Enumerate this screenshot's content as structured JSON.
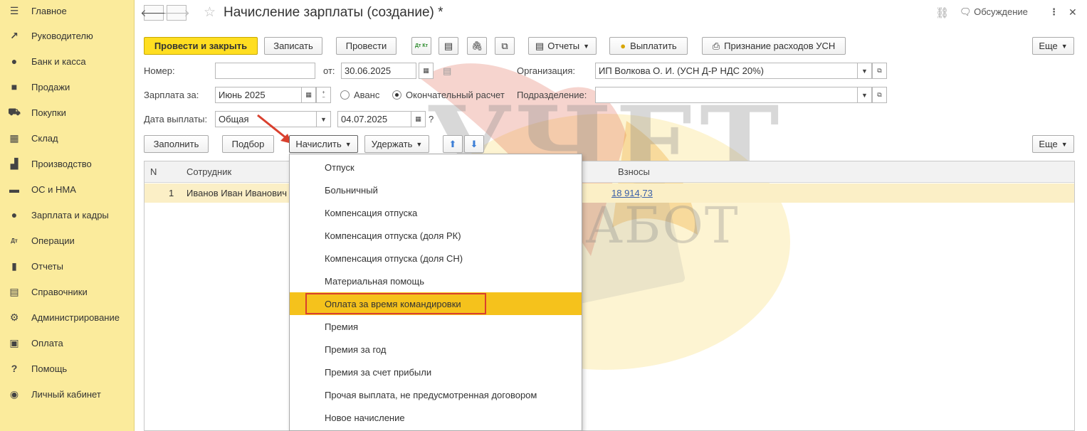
{
  "sidebar": {
    "items": [
      {
        "label": "Главное",
        "icon": "menu-icon"
      },
      {
        "label": "Руководителю",
        "icon": "trend-icon"
      },
      {
        "label": "Банк и касса",
        "icon": "coin-icon"
      },
      {
        "label": "Продажи",
        "icon": "bag-icon"
      },
      {
        "label": "Покупки",
        "icon": "cart-icon"
      },
      {
        "label": "Склад",
        "icon": "warehouse-icon"
      },
      {
        "label": "Производство",
        "icon": "factory-icon"
      },
      {
        "label": "ОС и НМА",
        "icon": "truck-icon"
      },
      {
        "label": "Зарплата и кадры",
        "icon": "person-icon"
      },
      {
        "label": "Операции",
        "icon": "dt-kt-icon"
      },
      {
        "label": "Отчеты",
        "icon": "bar-chart-icon"
      },
      {
        "label": "Справочники",
        "icon": "book-icon"
      },
      {
        "label": "Администрирование",
        "icon": "gear-icon"
      },
      {
        "label": "Оплата",
        "icon": "wallet-icon"
      },
      {
        "label": "Помощь",
        "icon": "question-icon"
      },
      {
        "label": "Личный кабинет",
        "icon": "user-circle-icon"
      }
    ]
  },
  "header": {
    "title": "Начисление зарплаты (создание) *",
    "discussion": "Обсуждение"
  },
  "toolbar": {
    "post_close": "Провести и закрыть",
    "save": "Записать",
    "post": "Провести",
    "dt_kt": "Дт Кт",
    "reports": "Отчеты",
    "pay": "Выплатить",
    "usn": "Признание расходов УСН",
    "more": "Еще"
  },
  "form": {
    "number_label": "Номер:",
    "number_value": "",
    "from_label": "от:",
    "date_value": "30.06.2025",
    "org_label": "Организация:",
    "org_value": "ИП Волкова О. И. (УСН Д-Р НДС 20%)",
    "salary_label": "Зарплата за:",
    "salary_value": "Июнь 2025",
    "advance_label": "Аванс",
    "final_label": "Окончательный расчет",
    "division_label": "Подразделение:",
    "division_value": "",
    "pay_date_label": "Дата выплаты:",
    "pay_date_type": "Общая",
    "pay_date_value": "04.07.2025",
    "help_mark": "?"
  },
  "table_toolbar": {
    "fill": "Заполнить",
    "select": "Подбор",
    "accrue": "Начислить",
    "deduct": "Удержать",
    "more": "Еще"
  },
  "table": {
    "headers": [
      "N",
      "Сотрудник",
      "Взносы"
    ],
    "rows": [
      {
        "n": "1",
        "employee": "Иванов Иван Иванович",
        "contributions": "18 914,73"
      }
    ]
  },
  "menu": {
    "items": [
      "Отпуск",
      "Больничный",
      "Компенсация отпуска",
      "Компенсация отпуска (доля РК)",
      "Компенсация отпуска (доля СН)",
      "Материальная помощь",
      "Оплата за время командировки",
      "Премия",
      "Премия за год",
      "Премия за счет прибыли",
      "Прочая выплата, не предусмотренная договором",
      "Новое начисление"
    ],
    "highlighted_index": 6
  },
  "watermark": {
    "line1": "УЧЕТ",
    "line2": "БЕЗ ЗАБОТ"
  },
  "colors": {
    "sidebar_bg": "#fbeb9c",
    "primary_button": "#ffde21",
    "menu_highlight": "#f5c21c",
    "annotation_red": "#d9402e",
    "row_selected": "#fbefc6"
  }
}
